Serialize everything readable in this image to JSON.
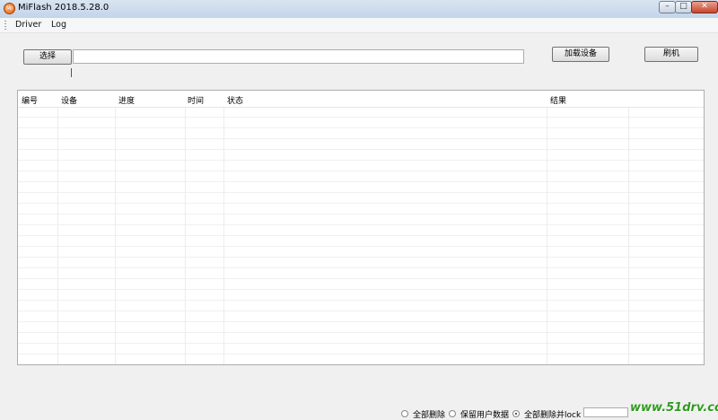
{
  "window": {
    "title": "MiFlash 2018.5.28.0",
    "min_glyph": "–",
    "max_glyph": "□",
    "close_glyph": "✕"
  },
  "menu": {
    "items": [
      "Driver",
      "Log"
    ]
  },
  "toolbar": {
    "select_label": "选择",
    "path_value": "",
    "load_device_label": "加载设备",
    "flash_label": "刷机"
  },
  "table": {
    "columns": [
      "编号",
      "设备",
      "进度",
      "时间",
      "状态",
      "结果"
    ],
    "rows": []
  },
  "options": {
    "items": [
      "全部删除",
      "保留用户数据",
      "全部删除并lock"
    ],
    "selected_index": 2
  },
  "watermark": "www.51drv.com",
  "colors": {
    "titlebar": "#c3d4ea",
    "background": "#f0f0f0",
    "watermark": "#2f9b1f"
  }
}
